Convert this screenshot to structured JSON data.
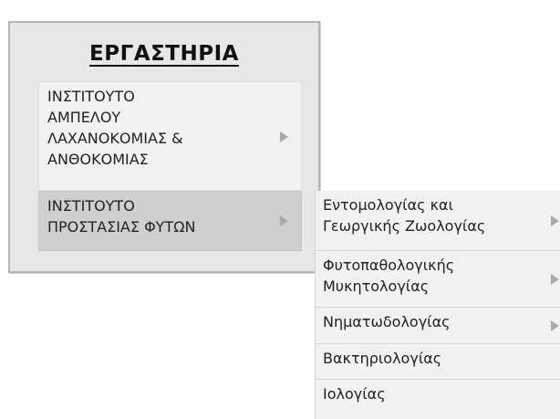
{
  "panel": {
    "title": "ΕΡΓΑΣΤΗΡΙΑ"
  },
  "menu": {
    "items": [
      {
        "lines": [
          "ΙΝΣΤΙΤΟΥΤΟ",
          "ΑΜΠΕΛΟΥ",
          "ΛΑΧΑΝΟΚΟΜΙΑΣ &",
          "ΑΝΘΟΚΟΜΙΑΣ"
        ],
        "has_submenu": true,
        "state": "normal"
      },
      {
        "lines": [
          "ΙΝΣΤΙΤΟΥΤΟ",
          "ΠΡΟΣΤΑΣΙΑΣ ΦΥΤΩΝ"
        ],
        "has_submenu": true,
        "state": "hover"
      }
    ]
  },
  "submenu": {
    "items": [
      {
        "lines": [
          "Εντομολογίας και",
          "Γεωργικής Ζωολογίας"
        ],
        "has_submenu": true
      },
      {
        "lines": [
          "Φυτοπαθολογικής",
          "Μυκητολογίας"
        ],
        "has_submenu": true
      },
      {
        "lines": [
          "Νηματωδολογίας"
        ],
        "has_submenu": true
      },
      {
        "lines": [
          "Βακτηριολογίας"
        ],
        "has_submenu": false
      },
      {
        "lines": [
          "Ιολογίας"
        ],
        "has_submenu": false
      }
    ]
  },
  "icons": {
    "submenu_arrow": "triangle-right-icon"
  },
  "colors": {
    "panel_bg": "#e7e7e7",
    "panel_border": "#b4b4b4",
    "item_bg": "#f1f1f1",
    "item_hover_bg": "#cfcfcf",
    "arrow": "#a9a9a9",
    "text": "#222222"
  }
}
